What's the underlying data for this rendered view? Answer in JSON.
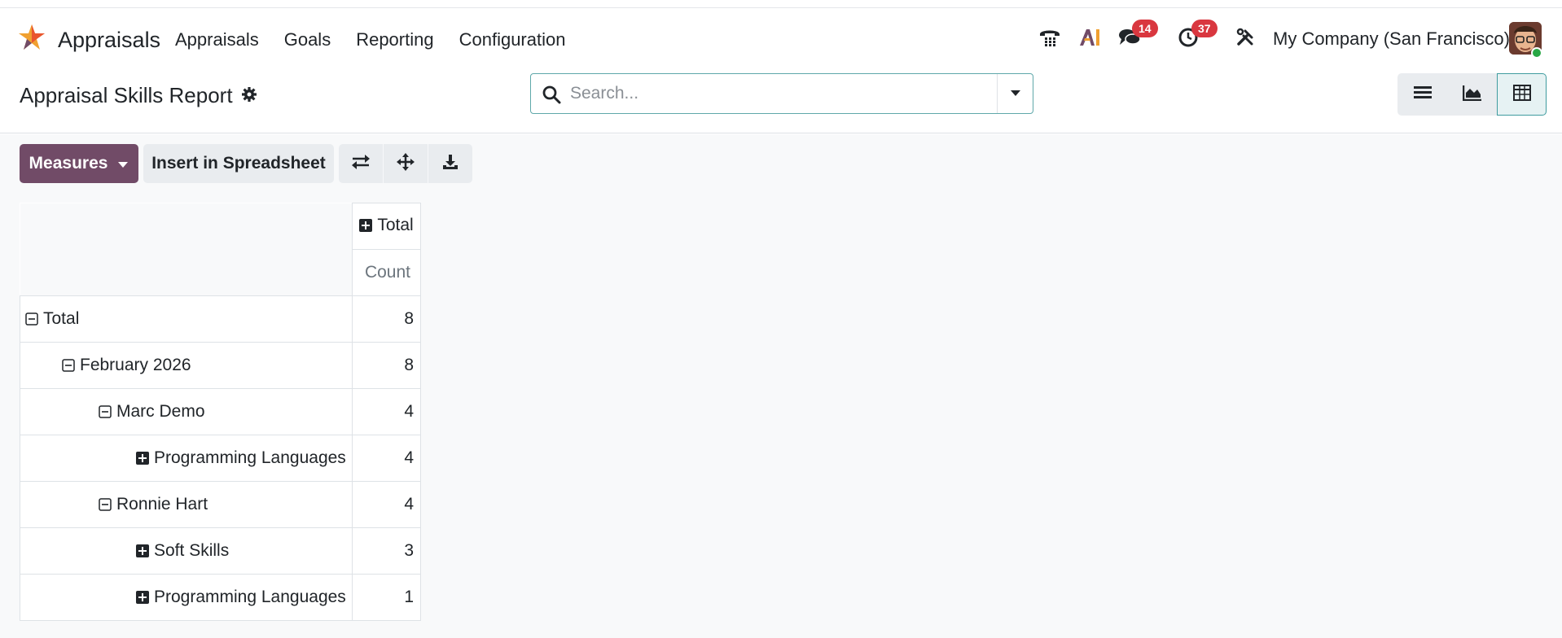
{
  "app": {
    "name": "Appraisals"
  },
  "menu": [
    "Appraisals",
    "Goals",
    "Reporting",
    "Configuration"
  ],
  "systray": {
    "messages_count": "14",
    "activities_count": "37",
    "company": "My Company (San Francisco)"
  },
  "page": {
    "title": "Appraisal Skills Report"
  },
  "search": {
    "placeholder": "Search..."
  },
  "toolbar": {
    "measures_label": "Measures",
    "insert_label": "Insert in Spreadsheet"
  },
  "pivot": {
    "col_total_label": "Total",
    "measure_label": "Count",
    "rows": [
      {
        "label": "Total",
        "value": "8",
        "expanded": true
      },
      {
        "label": "February 2026",
        "value": "8",
        "expanded": true
      },
      {
        "label": "Marc Demo",
        "value": "4",
        "expanded": true
      },
      {
        "label": "Programming Languages",
        "value": "4",
        "expanded": false
      },
      {
        "label": "Ronnie Hart",
        "value": "4",
        "expanded": true
      },
      {
        "label": "Soft Skills",
        "value": "3",
        "expanded": false
      },
      {
        "label": "Programming Languages",
        "value": "1",
        "expanded": false
      }
    ]
  },
  "colors": {
    "brand": "#714b67",
    "badge": "#d9373f",
    "accent": "#3f9c9f"
  }
}
